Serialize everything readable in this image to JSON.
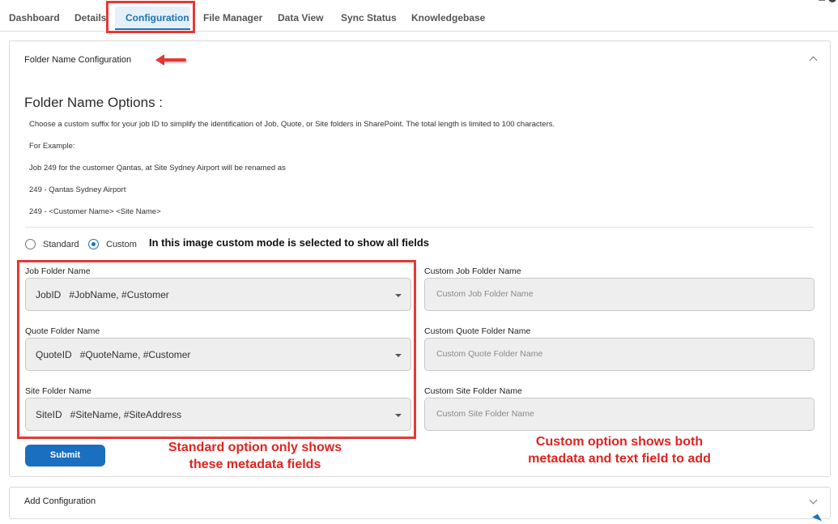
{
  "tabs": [
    "Dashboard",
    "Details",
    "Configuration",
    "File Manager",
    "Data View",
    "Sync Status",
    "Knowledgebase"
  ],
  "active_tab": "Configuration",
  "accent_color": "#1a73b8",
  "annotation_color": "#e53935",
  "panel": {
    "title": "Folder Name Configuration",
    "heading": "Folder Name Options :",
    "description": [
      "Choose a custom suffix for your job ID to simplify the identification of Job, Quote, or Site folders in SharePoint. The total length is limited to 100 characters.",
      "For Example:",
      "Job 249 for the customer Qantas, at Site Sydney Airport will be renamed as",
      "249 - Qantas Sydney Airport",
      "249 - <Customer Name> <Site Name>"
    ],
    "mode": {
      "options": [
        "Standard",
        "Custom"
      ],
      "selected": "Custom",
      "note": "In this image custom mode is selected to show all fields"
    },
    "fields": [
      {
        "label": "Job Folder Name",
        "value": "JobID   #JobName, #Customer",
        "custom_label": "Custom Job Folder Name",
        "custom_placeholder": "Custom Job Folder Name"
      },
      {
        "label": "Quote Folder Name",
        "value": "QuoteID   #QuoteName, #Customer",
        "custom_label": "Custom Quote Folder Name",
        "custom_placeholder": "Custom Quote Folder Name"
      },
      {
        "label": "Site Folder Name",
        "value": "SiteID   #SiteName, #SiteAddress",
        "custom_label": "Custom Site Folder Name",
        "custom_placeholder": "Custom Site Folder Name"
      }
    ],
    "submit_label": "Submit",
    "standard_note": [
      "Standard option only shows",
      "these metadata fields"
    ],
    "custom_note": [
      "Custom option shows both",
      "metadata and text field to add"
    ]
  },
  "panel2": {
    "title": "Add Configuration"
  }
}
